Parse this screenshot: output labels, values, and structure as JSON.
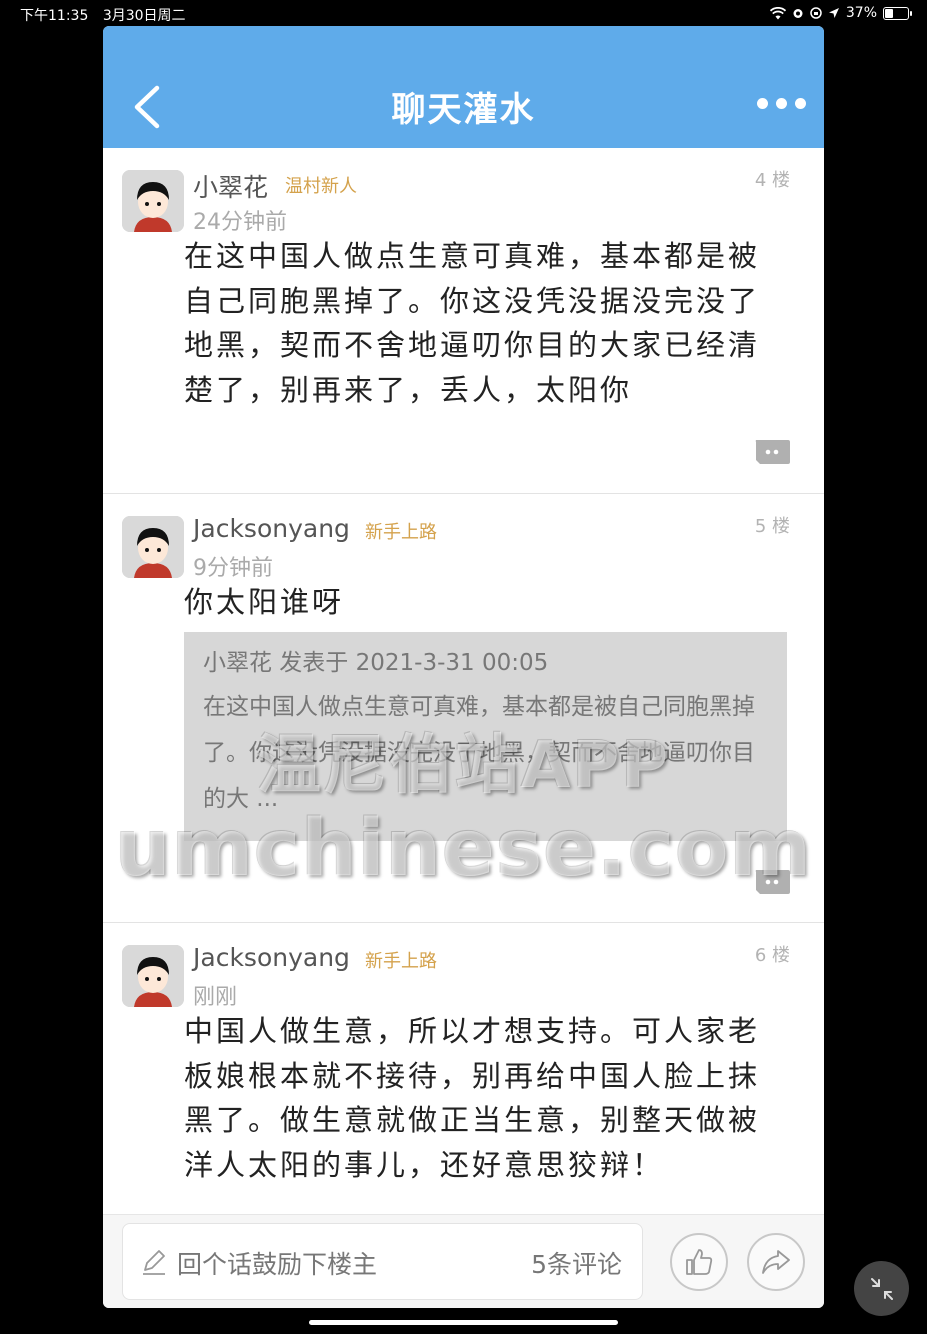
{
  "status_bar": {
    "time": "下午11:35",
    "date": "3月30日周二",
    "battery": "37%",
    "battery_level": 0.37
  },
  "header": {
    "title": "聊天灌水",
    "back_icon": "chevron-left-icon",
    "more_icon": "more-dots-icon"
  },
  "posts": [
    {
      "author": "小翠花",
      "badge": "温村新人",
      "time": "24分钟前",
      "floor": "4 楼",
      "body": "在这中国人做点生意可真难，基本都是被自己同胞黑掉了。你这没凭没据没完没了地黑，契而不舍地逼叨你目的大家已经清楚了，别再来了，丢人，太阳你"
    },
    {
      "author": "Jacksonyang",
      "badge": "新手上路",
      "time": "9分钟前",
      "floor": "5 楼",
      "body": "你太阳谁呀",
      "quote": {
        "header": "小翠花 发表于 2021-3-31 00:05",
        "text": "在这中国人做点生意可真难，基本都是被自己同胞黑掉了。你这没凭没据没完没了地黑，契而不舍地逼叨你目的大 ..."
      }
    },
    {
      "author": "Jacksonyang",
      "badge": "新手上路",
      "time": "刚刚",
      "floor": "6 楼",
      "body": "中国人做生意，所以才想支持。可人家老板娘根本就不接待，别再给中国人脸上抹黑了。做生意就做正当生意，别整天做被洋人太阳的事儿，还好意思狡辩！"
    }
  ],
  "watermark": {
    "line1": "温尼伯站APP",
    "line2": "umchinese.com"
  },
  "bottom_bar": {
    "placeholder": "回个话鼓励下楼主",
    "comment_count": "5条评论",
    "like_icon": "thumbs-up-icon",
    "share_icon": "share-arrow-icon"
  },
  "colors": {
    "header_bg": "#5fabea",
    "badge": "#d4a24c",
    "quote_bg": "#d7d7d7"
  }
}
